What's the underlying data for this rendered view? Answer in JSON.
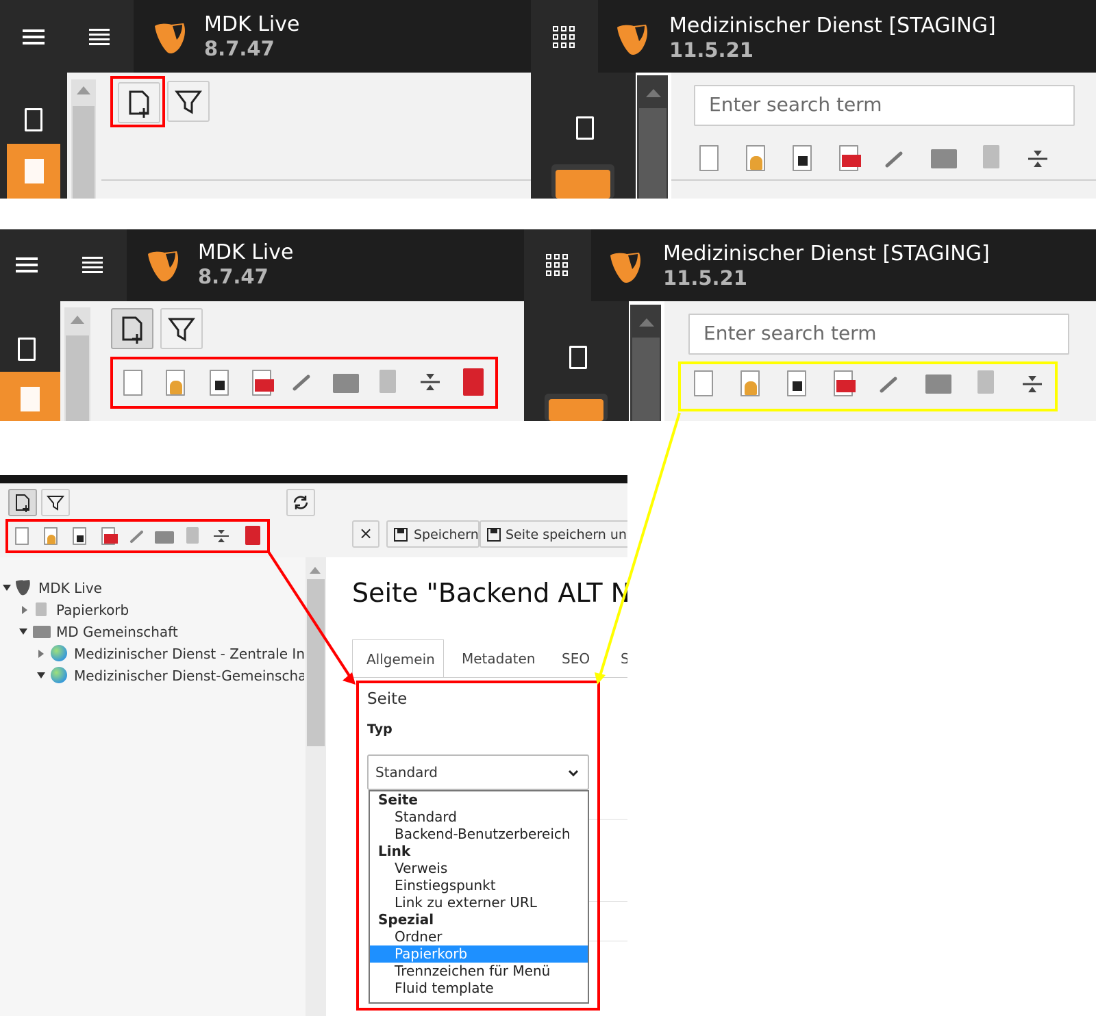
{
  "panel_live": {
    "site_name": "MDK Live",
    "version": "8.7.47"
  },
  "panel_staging": {
    "site_name": "Medizinischer Dienst [STAGING]",
    "version": "11.5.21",
    "search_placeholder": "Enter search term"
  },
  "tree": {
    "root": "MDK Live",
    "items": [
      "Papierkorb",
      "MD Gemeinschaft",
      "Medizinischer Dienst - Zentrale Inh",
      "Medizinischer Dienst-Gemeinschaft"
    ]
  },
  "toolbar": {
    "close_label": "×",
    "save_label": "Speichern",
    "save_view_label": "Seite speichern und"
  },
  "editor": {
    "page_title": "Seite \"Backend ALT NEU",
    "tabs": [
      "Allgemein",
      "Metadaten",
      "SEO",
      "S"
    ],
    "section_title": "Seite",
    "field_label": "Typ",
    "select_value": "Standard",
    "dropdown": [
      {
        "group": "Seite",
        "options": [
          "Standard",
          "Backend-Benutzerbereich"
        ]
      },
      {
        "group": "Link",
        "options": [
          "Verweis",
          "Einstiegspunkt",
          "Link zu externer URL"
        ]
      },
      {
        "group": "Spezial",
        "options": [
          "Ordner",
          "Papierkorb",
          "Trennzeichen für Menü",
          "Fluid template"
        ]
      }
    ],
    "selected_option": "Papierkorb"
  },
  "colors": {
    "typo3_orange": "#f18f2d",
    "header_dark": "#1e1e1e",
    "highlight_red": "#ff0000",
    "highlight_yellow": "#ffff00",
    "selection_blue": "#1e90ff"
  }
}
